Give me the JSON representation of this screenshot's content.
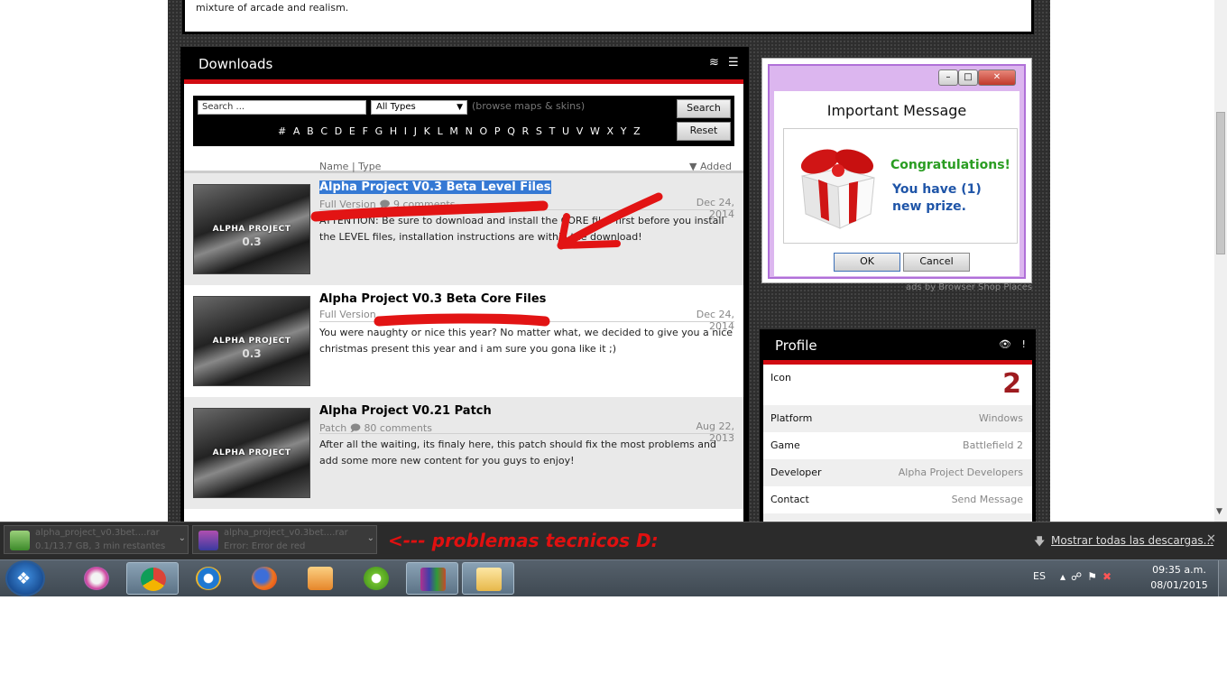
{
  "top_excerpt": "mixture of arcade and realism.",
  "downloads": {
    "title": "Downloads",
    "header_icons": [
      "rss-icon",
      "list-icon"
    ],
    "search": {
      "placeholder": "Search ...",
      "value": "Search ..."
    },
    "type_select": "All Types",
    "browse_hint": "(browse maps & skins)",
    "search_button": "Search",
    "reset_button": "Reset",
    "alphabet": "# A B C D E F G H I J K L M N O P Q R S T U V W X Y Z",
    "sort_name": "Name",
    "sort_sep": "|",
    "sort_type": "Type",
    "sort_added": "Added",
    "items": [
      {
        "title": "Alpha Project V0.3 Beta Level Files",
        "type": "Full Version",
        "comments": "9 comments",
        "date": "Dec 24, 2014",
        "description": "ATTENTION: Be sure to download and install the CORE files first before you install the LEVEL files, installation instructions are within the download!",
        "thumb_label": "ALPHA PROJECT",
        "thumb_version": "0.3"
      },
      {
        "title": "Alpha Project V0.3 Beta Core Files",
        "type": "Full Version",
        "comments": "",
        "date": "Dec 24, 2014",
        "description": "You were naughty or nice this year? No matter what, we decided to give you a nice christmas present this year and i am sure you gona like it ;)",
        "thumb_label": "ALPHA PROJECT",
        "thumb_version": "0.3"
      },
      {
        "title": "Alpha Project V0.21 Patch",
        "type": "Patch",
        "comments": "80 comments",
        "date": "Aug 22, 2013",
        "description": "After all the waiting, its finaly here, this patch should fix the most problems and add some more new content for you guys to enjoy!",
        "thumb_label": "ALPHA PROJECT",
        "thumb_version": ""
      }
    ]
  },
  "ad": {
    "heading": "Important Message",
    "congrats": "Congratulations!",
    "prize_line1": "You have (1)",
    "prize_line2": "new prize.",
    "ok": "OK",
    "cancel": "Cancel",
    "window_buttons": [
      "minimize-icon",
      "maximize-icon",
      "close-icon"
    ],
    "footer": "ads by Browser Shop Places"
  },
  "profile": {
    "title": "Profile",
    "icon_label": "Icon",
    "icon_value": "2",
    "rows": [
      {
        "label": "Platform",
        "value": "Windows"
      },
      {
        "label": "Game",
        "value": "Battlefield 2"
      },
      {
        "label": "Developer",
        "value": "Alpha Project Developers"
      },
      {
        "label": "Contact",
        "value": "Send Message"
      }
    ]
  },
  "download_bar": {
    "files": [
      {
        "name": "alpha_project_v0.3bet....rar",
        "status": "0.1/13.7 GB, 3 min restantes"
      },
      {
        "name": "alpha_project_v0.3bet....rar",
        "status": "Error: Error de red"
      }
    ],
    "annotation": "<--- problemas tecnicos D:",
    "show_all": "Mostrar todas las descargas...",
    "close": "✕"
  },
  "taskbar": {
    "apps": [
      "start-orb",
      "samsung-kies",
      "chrome",
      "internet-explorer",
      "firefox",
      "media-player",
      "utorrent",
      "winrar",
      "file-explorer"
    ],
    "language": "ES",
    "time": "09:35 a.m.",
    "date": "08/01/2015"
  },
  "colors": {
    "accent_red": "#d10b12",
    "panel_black": "#000000",
    "selection_blue": "#3579d4",
    "congrats_green": "#2a9d22",
    "annotation_red": "#e01010"
  }
}
